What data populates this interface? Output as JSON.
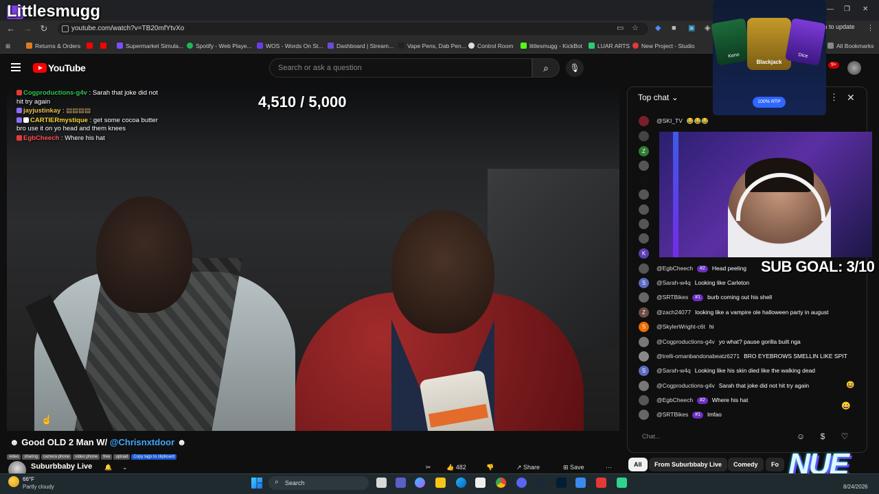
{
  "overlay": {
    "streamer_name": "Littlesmugg",
    "counter": "4,510 / 5,000",
    "sub_goal": "SUB GOAL: 3/10",
    "brand": "NUE",
    "casino": {
      "cards": [
        "Keno",
        "Blackjack",
        "Dice"
      ],
      "rtp_label": "100% RTP"
    },
    "stream_chat": [
      {
        "user": "Cogproductions-g4v",
        "msg": "Sarah that joke did not hit try again",
        "color": "#2ec44b"
      },
      {
        "user": "jayjustinkay",
        "msg": "",
        "color": "#e8c04a"
      },
      {
        "user": "CARTIERmystique",
        "msg": "get some cocoa butter bro use it on yo head and them knees",
        "color": "#f5d43a"
      },
      {
        "user": "EgbCheech",
        "msg": "Where his hat",
        "color": "#ff4f4f"
      }
    ]
  },
  "browser": {
    "url": "youtube.com/watch?v=TB20mfYtvXo",
    "update_label": "nch to update",
    "bookmarks": [
      {
        "label": "Returns & Orders",
        "color": "#e07a22"
      },
      {
        "label": "Supermarket Simula...",
        "color": "#7c4dff"
      },
      {
        "label": "Spotify - Web Playe...",
        "color": "#1db954"
      },
      {
        "label": "WOS - Words On St...",
        "color": "#6a3de8"
      },
      {
        "label": "Dashboard | Stream...",
        "color": "#6b4bd8"
      },
      {
        "label": "Vape Pens, Dab Pen...",
        "color": "#222222"
      },
      {
        "label": "Control Room",
        "color": "#dddddd"
      },
      {
        "label": "littlesmugg - KickBot",
        "color": "#53fc18"
      },
      {
        "label": "LUAR ARTS",
        "color": "#2ecc71"
      },
      {
        "label": "New Project - Studio",
        "color": "#e53935"
      }
    ],
    "all_bookmarks": "All Bookmarks"
  },
  "youtube": {
    "logo_text": "YouTube",
    "search_placeholder": "Search or ask a question",
    "notification_count": "9+",
    "video_title_prefix": "Good OLD 2 Man W/ ",
    "video_title_mention": "@Chrisnxtdoor",
    "tags": [
      "video",
      "sharing",
      "camera phone",
      "video phone",
      "free",
      "upload"
    ],
    "copy_tags": "Copy tags to clipboard",
    "channel_name": "Suburbbaby Live",
    "like_count": "482",
    "share_label": "Share",
    "save_label": "Save"
  },
  "chat": {
    "header": "Top chat",
    "input_placeholder": "Chat...",
    "top_message": {
      "user": "@SKI_TV",
      "msg": "😂😂😂"
    },
    "messages": [
      {
        "user": "@EgbCheech",
        "badge": "#2",
        "msg": "Head peeling",
        "avatar": "#555555",
        "initial": ""
      },
      {
        "user": "@Sarah-w4q",
        "badge": "",
        "msg": "Looking like Carleton",
        "avatar": "#5c6bc0",
        "initial": "S"
      },
      {
        "user": "@SRTBikes",
        "badge": "#1",
        "msg": "burb coming out his shell",
        "avatar": "#666666",
        "initial": ""
      },
      {
        "user": "@zach24077",
        "badge": "",
        "msg": "looking like a vampire ole halloween party in august",
        "avatar": "#6d4c41",
        "initial": "Z"
      },
      {
        "user": "@SkylerWright-c6t",
        "badge": "",
        "msg": "hi",
        "avatar": "#ef6c00",
        "initial": "S"
      },
      {
        "user": "@Cogproductions-g4v",
        "badge": "",
        "msg": "yo what? pause gorilla built nga",
        "avatar": "#777777",
        "initial": ""
      },
      {
        "user": "@trelli-omanbandonabeatz6271",
        "badge": "",
        "msg": "BRO EYEBROWS SMELLIN LIKE SPIT",
        "avatar": "#888888",
        "initial": ""
      },
      {
        "user": "@Sarah-w4q",
        "badge": "",
        "msg": "Looking like his skin died like the walking dead",
        "avatar": "#5c6bc0",
        "initial": "S"
      },
      {
        "user": "@Cogproductions-g4v",
        "badge": "",
        "msg": "Sarah that joke did not hit try again",
        "avatar": "#777777",
        "initial": ""
      },
      {
        "user": "@EgbCheech",
        "badge": "#2",
        "msg": "Where his hat",
        "avatar": "#555555",
        "initial": ""
      },
      {
        "user": "@SRTBikes",
        "badge": "#1",
        "msg": "lmfao",
        "avatar": "#666666",
        "initial": ""
      }
    ]
  },
  "chips": [
    "All",
    "From Suburbbaby Live",
    "Comedy",
    "Fo"
  ],
  "taskbar": {
    "temperature": "66°F",
    "weather": "Partly cloudy",
    "search_label": "Search",
    "date": "8/24/2026"
  }
}
